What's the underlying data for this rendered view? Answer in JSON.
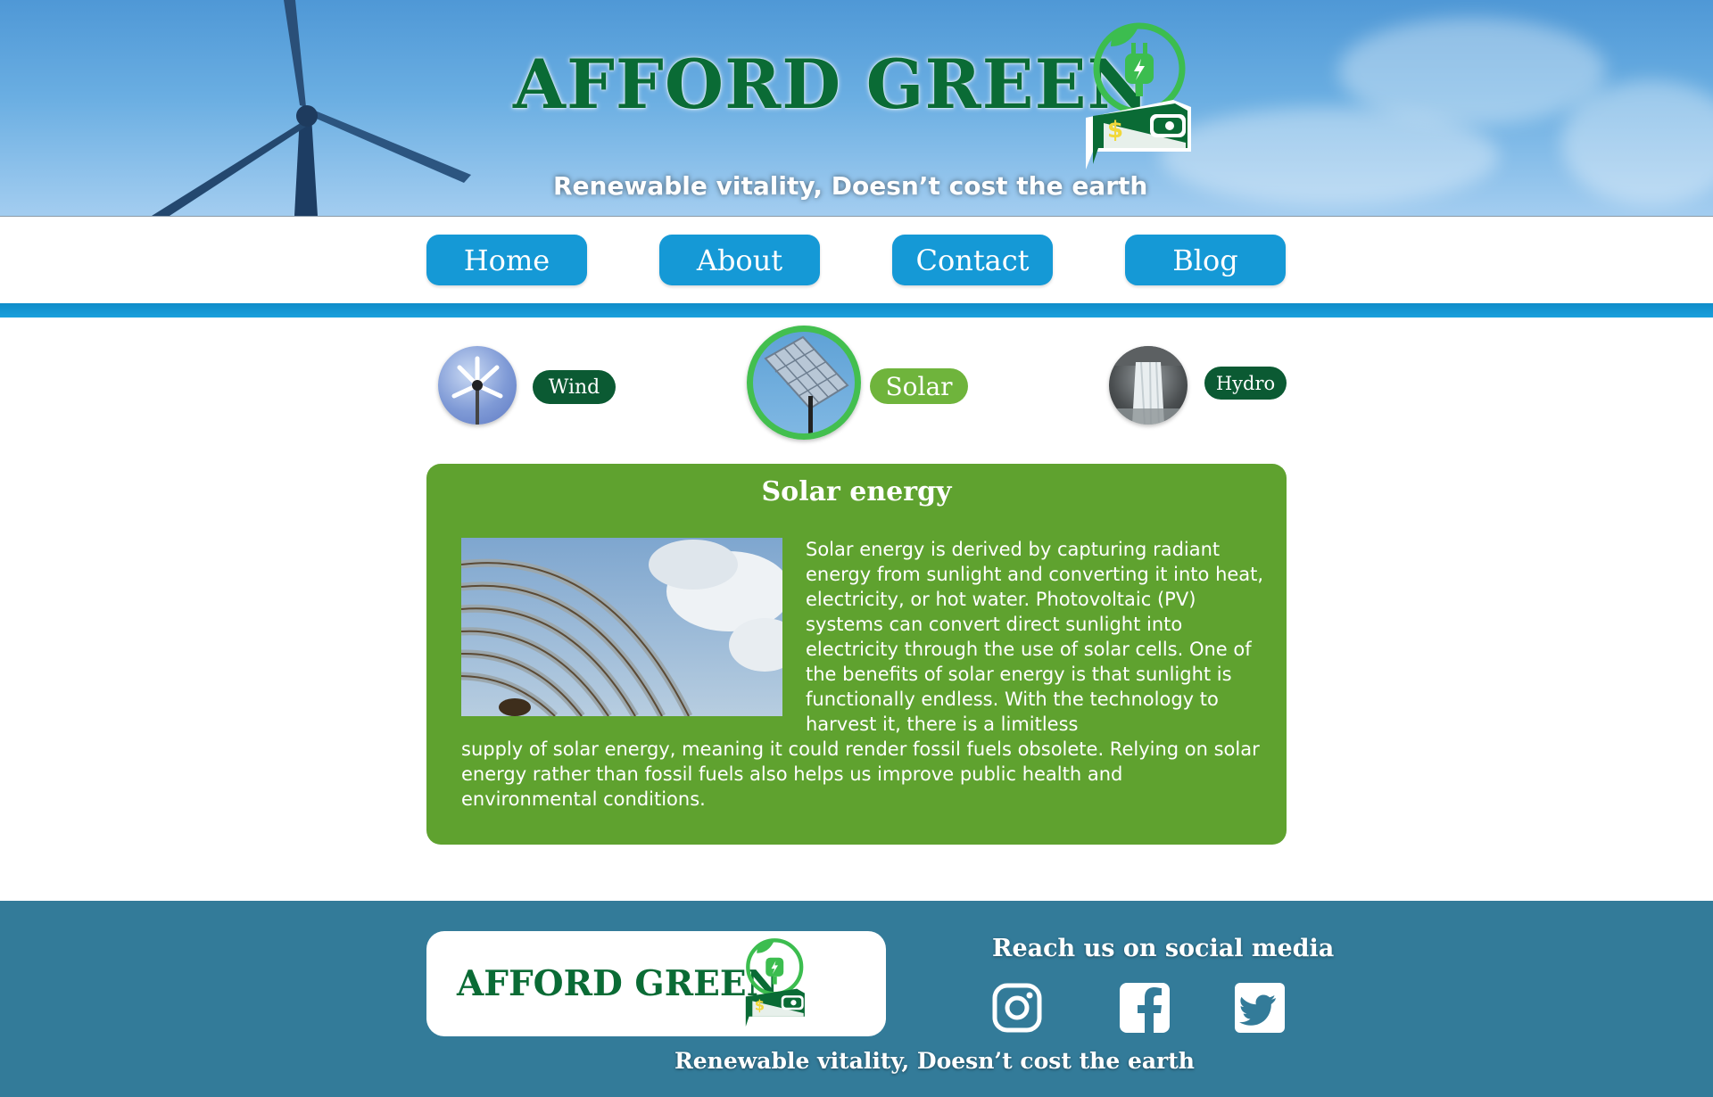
{
  "brand": {
    "name": "AFFORD GREEN",
    "tagline": "Renewable vitality, Doesn’t cost the earth",
    "logo_icon": "plug-leaf-wallet-icon",
    "colors": {
      "brand_green": "#0a6b35",
      "accent_green": "#3cbd4f",
      "nav_blue": "#1599d6",
      "footer_teal": "#337b99"
    }
  },
  "nav": {
    "items": [
      {
        "label": "Home"
      },
      {
        "label": "About"
      },
      {
        "label": "Contact"
      },
      {
        "label": "Blog"
      }
    ]
  },
  "energy_tabs": [
    {
      "label": "Wind",
      "icon": "wind-turbine-image",
      "active": false
    },
    {
      "label": "Solar",
      "icon": "solar-panel-image",
      "active": true
    },
    {
      "label": "Hydro",
      "icon": "waterfall-image",
      "active": false
    }
  ],
  "content": {
    "title": "Solar energy",
    "image": "solar-mirror-array-image",
    "paragraph_top": "Solar energy is derived by capturing radiant energy from sunlight and converting it into heat, electricity, or hot water. Photovoltaic (PV) systems can convert direct sunlight into electricity through the use of solar cells. One of the benefits of solar energy is that sunlight is functionally endless. With the technology to harvest it, there is a limitless",
    "paragraph_bottom": " supply of solar energy, meaning it could render fossil fuels obsolete. Relying on solar energy rather than fossil fuels also helps us improve public health and environmental conditions."
  },
  "footer": {
    "brand_name": "AFFORD GREEN",
    "social_title": "Reach us on social media",
    "social_icons": [
      "instagram-icon",
      "facebook-icon",
      "twitter-icon"
    ],
    "tagline": "Renewable vitality, Doesn’t cost the earth"
  }
}
